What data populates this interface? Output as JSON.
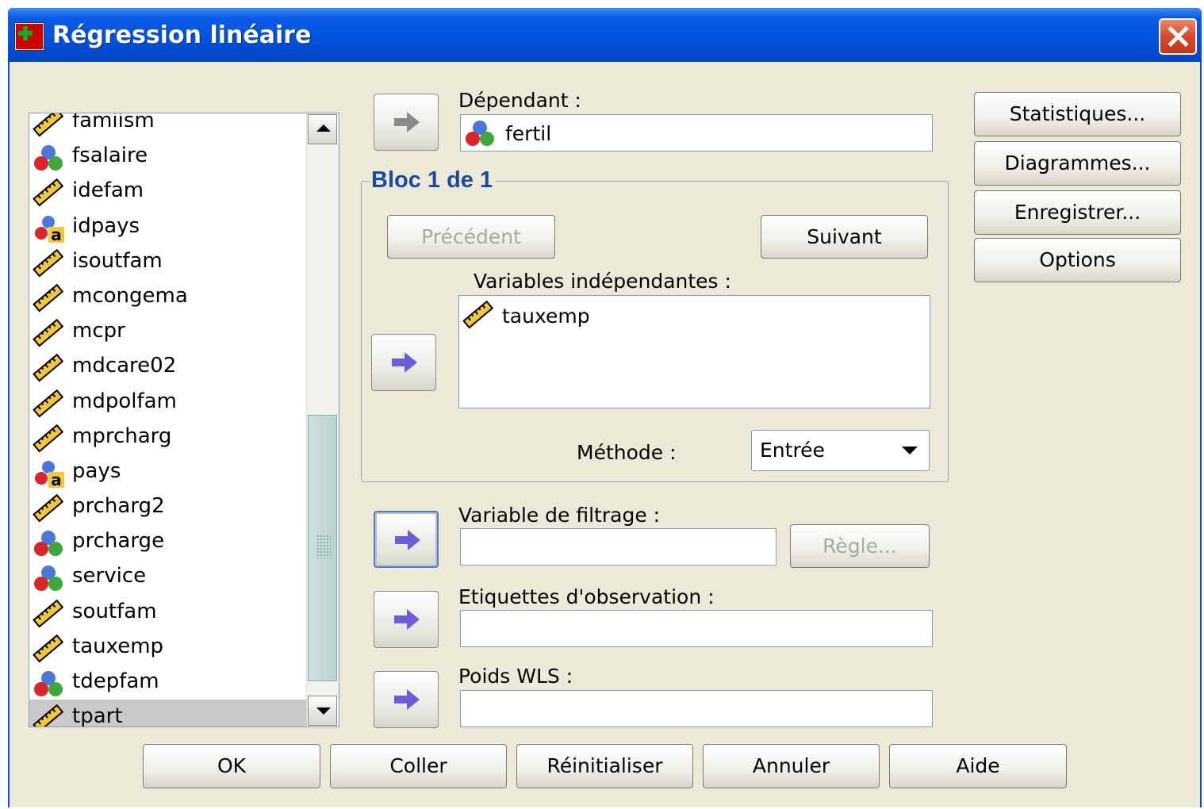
{
  "window": {
    "title": "Régression linéaire"
  },
  "variable_list": {
    "items": [
      {
        "name": "famiism",
        "type": "scale"
      },
      {
        "name": "fsalaire",
        "type": "nominal"
      },
      {
        "name": "idefam",
        "type": "scale"
      },
      {
        "name": "idpays",
        "type": "nominal-string"
      },
      {
        "name": "isoutfam",
        "type": "scale"
      },
      {
        "name": "mcongema",
        "type": "scale"
      },
      {
        "name": "mcpr",
        "type": "scale"
      },
      {
        "name": "mdcare02",
        "type": "scale"
      },
      {
        "name": "mdpolfam",
        "type": "scale"
      },
      {
        "name": "mprcharg",
        "type": "scale"
      },
      {
        "name": "pays",
        "type": "nominal-string"
      },
      {
        "name": "prcharg2",
        "type": "scale"
      },
      {
        "name": "prcharge",
        "type": "nominal"
      },
      {
        "name": "service",
        "type": "nominal"
      },
      {
        "name": "soutfam",
        "type": "scale"
      },
      {
        "name": "tauxemp",
        "type": "scale"
      },
      {
        "name": "tdepfam",
        "type": "nominal"
      },
      {
        "name": "tpart",
        "type": "scale",
        "selected": true
      }
    ]
  },
  "dependent": {
    "label": "Dépendant :",
    "value": "fertil",
    "icon": "nominal-icon"
  },
  "block": {
    "label": "Bloc 1 de 1",
    "previous_label": "Précédent",
    "next_label": "Suivant",
    "independents_label": "Variables indépendantes :",
    "independents": [
      {
        "name": "tauxemp",
        "icon": "scale-ruler-icon"
      }
    ],
    "method_label": "Méthode :",
    "method_value": "Entrée"
  },
  "selection_variable": {
    "label": "Variable de filtrage :",
    "value": "",
    "rule_label": "Règle..."
  },
  "case_labels": {
    "label": "Etiquettes d'observation :",
    "value": ""
  },
  "wls_weight": {
    "label": "Poids WLS :",
    "value": ""
  },
  "side_buttons": {
    "statistics": "Statistiques...",
    "plots": "Diagrammes...",
    "save": "Enregistrer...",
    "options": "Options"
  },
  "bottom_buttons": {
    "ok": "OK",
    "paste": "Coller",
    "reset": "Réinitialiser",
    "cancel": "Annuler",
    "help": "Aide"
  }
}
